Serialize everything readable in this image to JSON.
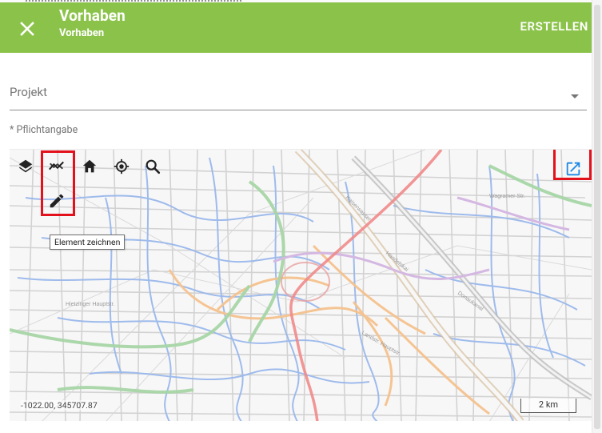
{
  "header": {
    "title": "Vorhaben",
    "subtitle": "Vorhaben",
    "create_label": "ERSTELLEN",
    "background_color": "#8bc34a",
    "close_icon": "close-icon"
  },
  "form": {
    "project_field": {
      "label": "Projekt",
      "value": ""
    },
    "required_hint": "* Pflichtangabe"
  },
  "map": {
    "toolbar": [
      {
        "name": "layers-icon"
      },
      {
        "name": "draw-line-icon"
      },
      {
        "name": "home-icon"
      },
      {
        "name": "locate-icon"
      },
      {
        "name": "search-icon"
      }
    ],
    "draw_tool_icon": "pencil-icon",
    "tooltip": "Element zeichnen",
    "coordinates": "-1022.00, 345707.87",
    "scale_label": "2 km",
    "open_external_icon": "open-in-new-icon",
    "highlight_color": "#e2111b",
    "icon_color": "#222222",
    "external_icon_color": "#1e88e5"
  }
}
